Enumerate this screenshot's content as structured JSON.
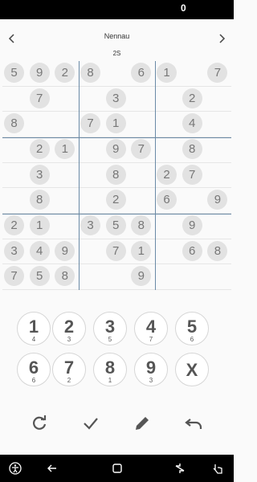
{
  "status": {
    "notification": "0"
  },
  "header": {
    "title": "Nennau",
    "prev_icon": "chevron-left-icon",
    "next_icon": "chevron-right-icon"
  },
  "timer": "2S",
  "board": [
    [
      "5",
      "9",
      "2",
      "8",
      "",
      "6",
      "1",
      "",
      "7"
    ],
    [
      "",
      "7",
      "",
      "",
      "3",
      "",
      "",
      "2",
      ""
    ],
    [
      "8",
      "",
      "",
      "7",
      "1",
      "",
      "",
      "4",
      ""
    ],
    [
      "",
      "2",
      "1",
      "",
      "9",
      "7",
      "",
      "8",
      ""
    ],
    [
      "",
      "3",
      "",
      "",
      "8",
      "",
      "2",
      "7",
      ""
    ],
    [
      "",
      "8",
      "",
      "",
      "2",
      "",
      "6",
      "",
      "9"
    ],
    [
      "2",
      "1",
      "",
      "3",
      "5",
      "8",
      "",
      "9",
      ""
    ],
    [
      "3",
      "4",
      "9",
      "",
      "7",
      "1",
      "",
      "6",
      "8"
    ],
    [
      "7",
      "5",
      "8",
      "",
      "",
      "9",
      "",
      "",
      ""
    ]
  ],
  "keypad": [
    {
      "digit": "1",
      "remaining": "4"
    },
    {
      "digit": "2",
      "remaining": "3"
    },
    {
      "digit": "3",
      "remaining": "5"
    },
    {
      "digit": "4",
      "remaining": "7"
    },
    {
      "digit": "5",
      "remaining": "6"
    },
    {
      "digit": "6",
      "remaining": "6"
    },
    {
      "digit": "7",
      "remaining": "2"
    },
    {
      "digit": "8",
      "remaining": "1"
    },
    {
      "digit": "9",
      "remaining": "3"
    },
    {
      "digit": "X",
      "remaining": ""
    }
  ],
  "tools": [
    "restart-icon",
    "check-icon",
    "pencil-icon",
    "undo-icon"
  ],
  "colors": {
    "box_lines": "#6a8aa6",
    "given_circle": "#e2e2e2",
    "digit_text": "#777777"
  }
}
